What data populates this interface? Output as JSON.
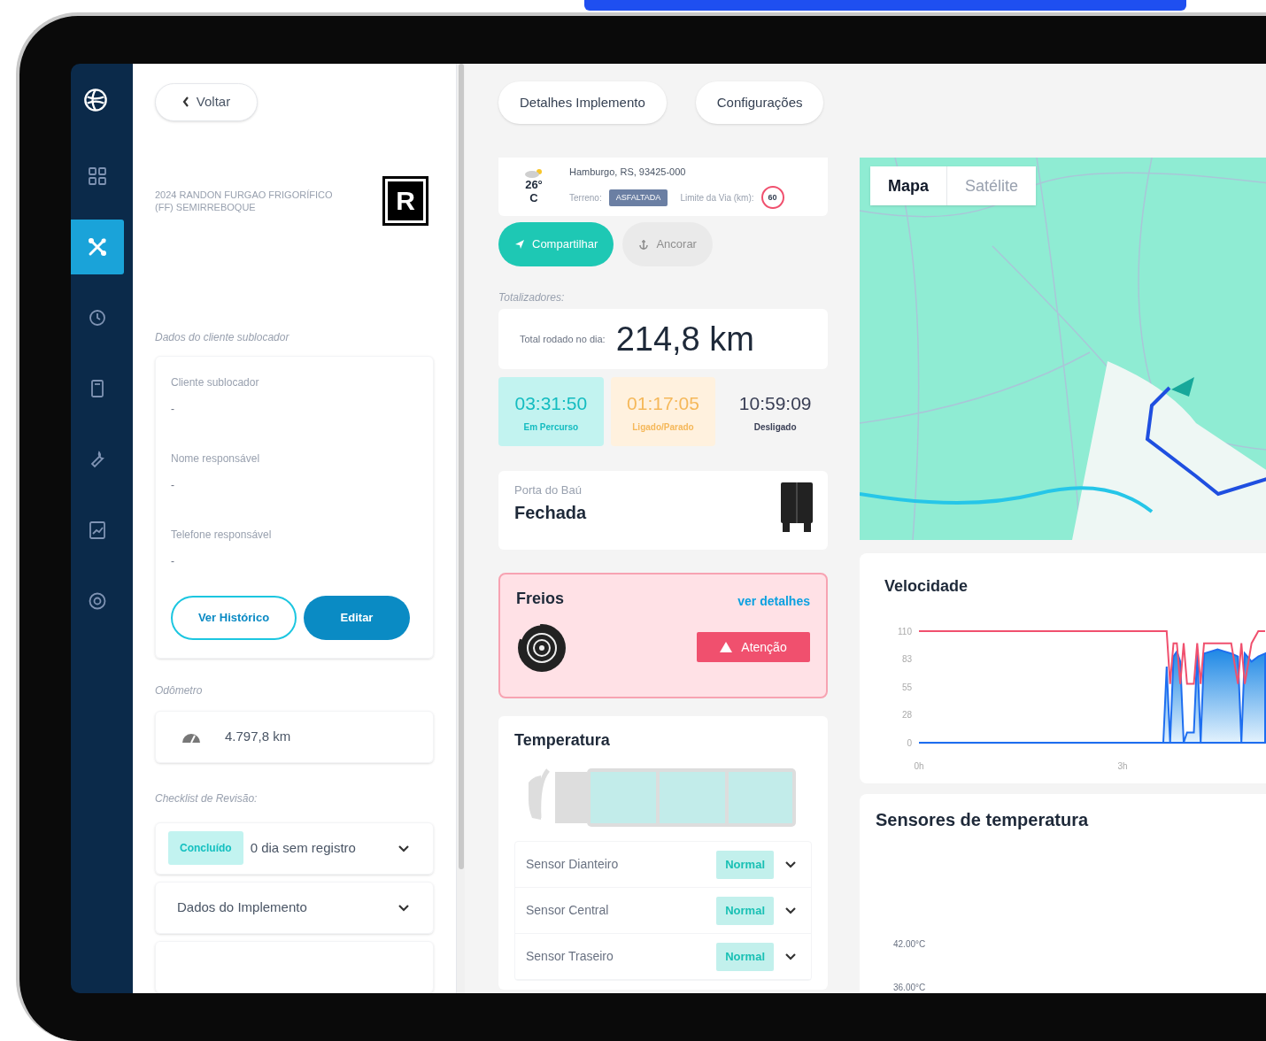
{
  "sidebar": {
    "items": [
      {
        "selected": false
      },
      {
        "selected": true
      },
      {
        "selected": false
      },
      {
        "selected": false
      },
      {
        "selected": false
      },
      {
        "selected": false
      },
      {
        "selected": false
      }
    ]
  },
  "back_button": {
    "label": "Voltar"
  },
  "implement": {
    "title": "2024 RANDON FURGAO FRIGORÍFICO (FF) SEMIRREBOQUE",
    "logo_letter": "R"
  },
  "client_section": {
    "heading": "Dados do cliente sublocador",
    "fields": [
      {
        "label": "Cliente sublocador",
        "value": "-"
      },
      {
        "label": "Nome responsável",
        "value": "-"
      },
      {
        "label": "Telefone responsável",
        "value": "-"
      }
    ],
    "buttons": [
      {
        "label": "Ver Histórico",
        "kind": "outline"
      },
      {
        "label": "Editar",
        "kind": "solid"
      }
    ]
  },
  "odometer": {
    "heading": "Odômetro",
    "value": "4.797,8 km"
  },
  "checklist": {
    "heading": "Checklist de Revisão:",
    "items": [
      {
        "badge": "Concluído",
        "label": "0 dia sem registro",
        "expanded": false
      },
      {
        "label": "Dados do Implemento",
        "expanded": false
      }
    ]
  },
  "tabs": [
    {
      "label": "Detalhes Implemento"
    },
    {
      "label": "Configurações"
    }
  ],
  "location_card": {
    "temperature": "26°",
    "temperature_unit": "C",
    "address": "Hamburgo, RS, 93425-000",
    "terrain_label": "Terreno:",
    "terrain": "ASFALTADA",
    "speed_limit_label": "Limite da Via (km):",
    "speed_limit": "60"
  },
  "actions": [
    {
      "label": "Compartilhar",
      "kind": "share",
      "disabled": false
    },
    {
      "label": "Ancorar",
      "kind": "anchor",
      "disabled": true
    }
  ],
  "totals": {
    "heading": "Totalizadores:",
    "distance_label": "Total rodado no dia:",
    "distance": "214,8 km",
    "times": [
      {
        "value": "03:31:50",
        "label": "Em Percurso",
        "kind": "moving"
      },
      {
        "value": "01:17:05",
        "label": "Ligado/Parado",
        "kind": "idle"
      },
      {
        "value": "10:59:09",
        "label": "Desligado",
        "kind": "off"
      }
    ]
  },
  "door": {
    "label": "Porta do Baú",
    "status": "Fechada"
  },
  "brakes": {
    "title": "Freios",
    "link": "ver detalhes",
    "status": "Atenção",
    "kind": "warning"
  },
  "temperature": {
    "title": "Temperatura",
    "sensors": [
      {
        "name": "Sensor Dianteiro",
        "status": "Normal",
        "expanded": false
      },
      {
        "name": "Sensor Central",
        "status": "Normal",
        "expanded": false
      },
      {
        "name": "Sensor Traseiro",
        "status": "Normal",
        "expanded": false
      }
    ]
  },
  "map": {
    "view_toggle": [
      {
        "label": "Mapa",
        "selected": true
      },
      {
        "label": "Satélite",
        "selected": false
      }
    ]
  },
  "speed_chart": {
    "title": "Velocidade",
    "chart_data": {
      "type": "line",
      "x": [
        0,
        3.6,
        3.65,
        3.7,
        3.75,
        3.8,
        3.85,
        3.9,
        3.95,
        4.0,
        4.05,
        4.1,
        4.15,
        4.2,
        4.3,
        4.4,
        4.5,
        4.6,
        4.7,
        4.75,
        4.8,
        4.9,
        5.0,
        5.1
      ],
      "series": [
        {
          "type": "line",
          "color": "#f0506e",
          "values": [
            110,
            110,
            110,
            58,
            98,
            98,
            58,
            98,
            58,
            58,
            58,
            98,
            58,
            98,
            98,
            98,
            98,
            98,
            58,
            98,
            58,
            98,
            110,
            110
          ]
        },
        {
          "type": "area",
          "color": "#1e6ef0",
          "values": [
            0,
            0,
            75,
            0,
            85,
            90,
            80,
            0,
            10,
            10,
            10,
            90,
            0,
            88,
            90,
            92,
            90,
            88,
            85,
            0,
            88,
            80,
            85,
            88
          ]
        }
      ],
      "xlim": [
        0,
        5.1
      ],
      "ylim": [
        0,
        110
      ],
      "xticks": [
        {
          "value": 0,
          "label": "0h"
        },
        {
          "value": 3,
          "label": "3h"
        }
      ],
      "yticks": [
        0,
        28,
        55,
        83,
        110
      ]
    }
  },
  "temperature_sensors_chart": {
    "title": "Sensores de temperatura",
    "yticks": [
      "42.00°C",
      "36.00°C"
    ]
  }
}
